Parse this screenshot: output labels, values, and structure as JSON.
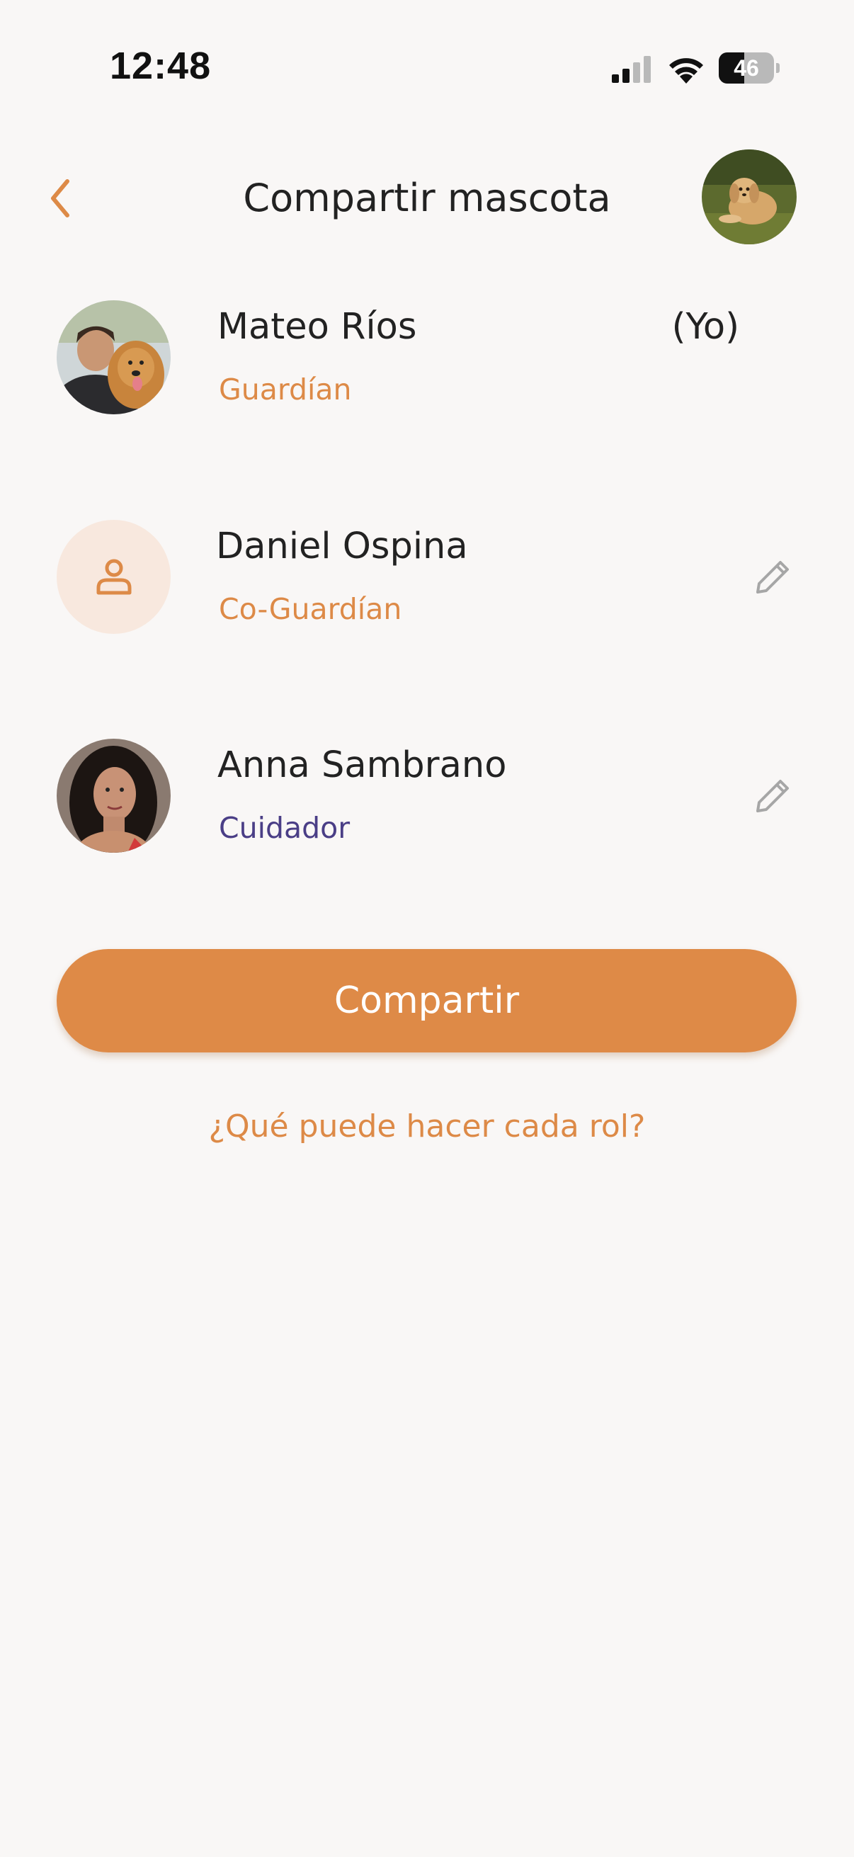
{
  "status_bar": {
    "time": "12:48",
    "battery": "46",
    "battery_level": 0.46,
    "icons": [
      "signal-icon",
      "wifi-icon",
      "battery-icon"
    ]
  },
  "header": {
    "title": "Compartir mascota",
    "back_icon": "chevron-left-icon"
  },
  "members": [
    {
      "name": "Mateo Ríos",
      "role": "Guardían",
      "tag": "(Yo)",
      "role_color": "#dd8a47"
    },
    {
      "name": "Daniel Ospina",
      "role": "Co-Guardían",
      "role_color": "#dd8a47",
      "avatar_icon": "user-icon"
    },
    {
      "name": "Anna Sambrano",
      "role": "Cuidador",
      "role_color": "#4a3e86"
    }
  ],
  "actions": {
    "share_label": "Compartir",
    "roles_link": "¿Qué puede hacer cada rol?"
  },
  "colors": {
    "accent": "#de8a47",
    "background": "#f9f7f6",
    "text": "#222222",
    "purple": "#4a3e86"
  }
}
